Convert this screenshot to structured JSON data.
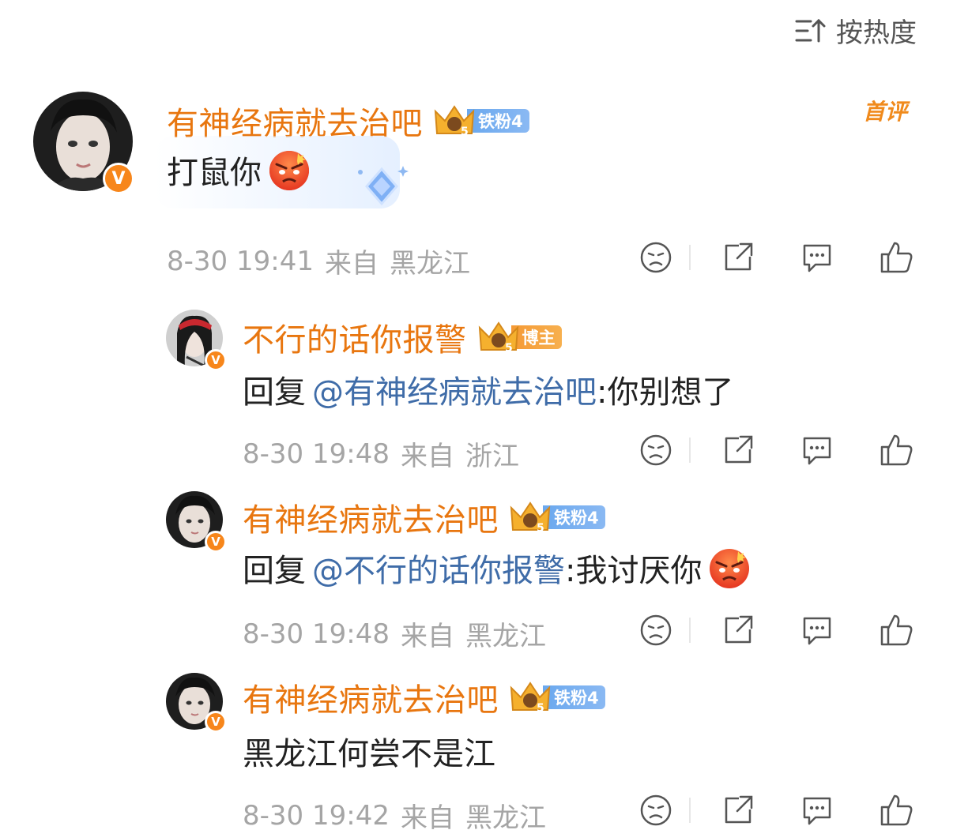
{
  "sort": {
    "label": "按热度",
    "icon": "sort-icon"
  },
  "comments": [
    {
      "username": "有神经病就去治吧",
      "fan_badge": "铁粉4",
      "badge_color": "blue",
      "first_tag": "首评",
      "text": "打鼠你",
      "date": "8-30 19:41",
      "from_label": "来自",
      "location": "黑龙江",
      "verified": "V"
    },
    {
      "username": "不行的话你报警",
      "fan_badge": "博主",
      "badge_color": "orange",
      "reply_prefix": "回复",
      "mention": "@有神经病就去治吧",
      "text": ":你别想了",
      "date": "8-30 19:48",
      "from_label": "来自",
      "location": "浙江",
      "verified": "V"
    },
    {
      "username": "有神经病就去治吧",
      "fan_badge": "铁粉4",
      "badge_color": "blue",
      "reply_prefix": "回复",
      "mention": "@不行的话你报警",
      "text": ":我讨厌你",
      "date": "8-30 19:48",
      "from_label": "来自",
      "location": "黑龙江",
      "verified": "V"
    },
    {
      "username": "有神经病就去治吧",
      "fan_badge": "铁粉4",
      "badge_color": "blue",
      "text": "黑龙江何尝不是江",
      "date": "8-30 19:42",
      "from_label": "来自",
      "location": "黑龙江",
      "verified": "V"
    }
  ],
  "colors": {
    "username": "#e8760f",
    "mention": "#3f6ca8",
    "meta": "#a5a5a5",
    "verified": "#f7861b"
  }
}
